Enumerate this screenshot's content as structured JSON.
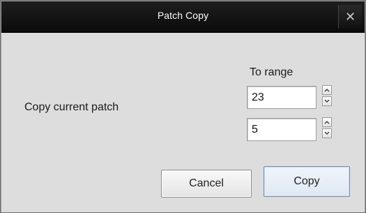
{
  "window": {
    "title": "Patch Copy",
    "close_glyph": "✕"
  },
  "form": {
    "copy_label": "Copy current patch",
    "range_label": "To range",
    "range_from": "23",
    "range_to": "5"
  },
  "buttons": {
    "cancel": "Cancel",
    "copy": "Copy"
  },
  "icons": {
    "close": "close-icon",
    "spin_up": "chevron-up-icon",
    "spin_down": "chevron-down-icon"
  },
  "colors": {
    "titlebar": "#111111",
    "dialog_background": "#dddddd",
    "default_button_border": "#6e8fb3"
  }
}
